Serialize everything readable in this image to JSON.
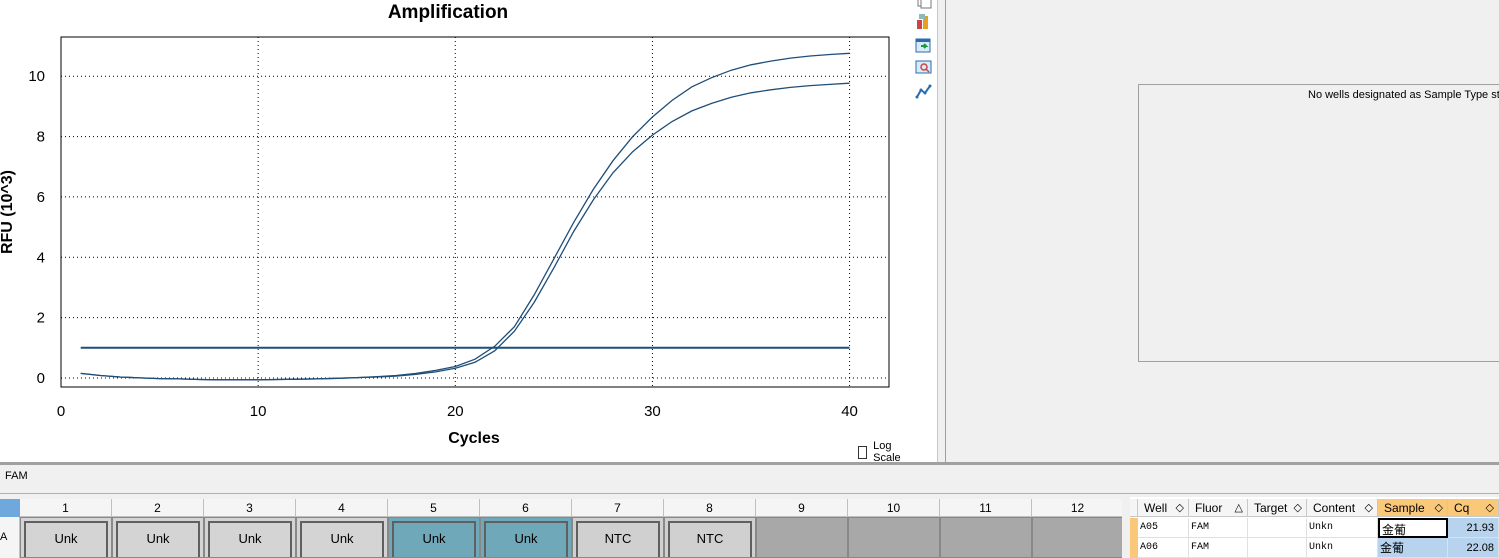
{
  "chart_data": {
    "type": "line",
    "title": "Amplification",
    "xlabel": "Cycles",
    "ylabel": "RFU (10^3)",
    "xlim": [
      0,
      42
    ],
    "ylim": [
      -0.3,
      11.3
    ],
    "xticks": [
      "0",
      "10",
      "20",
      "30",
      "40"
    ],
    "yticks": [
      "0",
      "2",
      "4",
      "6",
      "8",
      "10"
    ],
    "grid": true,
    "threshold": 1.0,
    "series": [
      {
        "x": [
          1,
          2,
          3,
          4,
          5,
          6,
          7,
          8,
          9,
          10,
          11,
          12,
          13,
          14,
          15,
          16,
          17,
          18,
          19,
          20,
          21,
          22,
          23,
          24,
          25,
          26,
          27,
          28,
          29,
          30,
          31,
          32,
          33,
          34,
          35,
          36,
          37,
          38,
          39,
          40
        ],
        "values": [
          0.15,
          0.08,
          0.03,
          0.0,
          -0.02,
          -0.03,
          -0.05,
          -0.06,
          -0.06,
          -0.06,
          -0.05,
          -0.04,
          -0.03,
          -0.01,
          0.01,
          0.04,
          0.08,
          0.15,
          0.25,
          0.38,
          0.62,
          1.05,
          1.7,
          2.75,
          3.95,
          5.15,
          6.25,
          7.2,
          8.0,
          8.65,
          9.2,
          9.65,
          9.95,
          10.2,
          10.38,
          10.5,
          10.6,
          10.67,
          10.72,
          10.76
        ]
      },
      {
        "x": [
          1,
          2,
          3,
          4,
          5,
          6,
          7,
          8,
          9,
          10,
          11,
          12,
          13,
          14,
          15,
          16,
          17,
          18,
          19,
          20,
          21,
          22,
          23,
          24,
          25,
          26,
          27,
          28,
          29,
          30,
          31,
          32,
          33,
          34,
          35,
          36,
          37,
          38,
          39,
          40
        ],
        "values": [
          0.15,
          0.08,
          0.03,
          0.0,
          -0.02,
          -0.03,
          -0.05,
          -0.06,
          -0.06,
          -0.06,
          -0.05,
          -0.04,
          -0.03,
          -0.01,
          0.01,
          0.03,
          0.06,
          0.12,
          0.2,
          0.32,
          0.52,
          0.9,
          1.55,
          2.5,
          3.65,
          4.85,
          5.9,
          6.8,
          7.5,
          8.05,
          8.5,
          8.85,
          9.1,
          9.3,
          9.45,
          9.55,
          9.63,
          9.69,
          9.73,
          9.77
        ]
      }
    ]
  },
  "log_scale_label": "Log Scale",
  "standard_curve_message": "No wells designated as Sample Type standard",
  "fluor_label": "FAM",
  "plate": {
    "row_label": "A",
    "columns": [
      "1",
      "2",
      "3",
      "4",
      "5",
      "6",
      "7",
      "8",
      "9",
      "10",
      "11",
      "12"
    ],
    "wells": [
      "Unk",
      "Unk",
      "Unk",
      "Unk",
      "Unk",
      "Unk",
      "NTC",
      "NTC",
      "",
      "",
      "",
      ""
    ]
  },
  "table": {
    "headers": [
      "Well",
      "Fluor",
      "Target",
      "Content",
      "Sample",
      "Cq"
    ],
    "rows": [
      {
        "well": "A05",
        "fluor": "FAM",
        "target": "",
        "content": "Unkn",
        "sample": "金葡",
        "cq": "21.93"
      },
      {
        "well": "A06",
        "fluor": "FAM",
        "target": "",
        "content": "Unkn",
        "sample": "金葡",
        "cq": "22.08"
      }
    ]
  },
  "colors": {
    "curve": "#1f4e79",
    "threshold": "#1f4e79",
    "selected_well": "#6fa8b8",
    "sort_header": "#f9c879",
    "selected_cell": "#b7d3ee"
  }
}
